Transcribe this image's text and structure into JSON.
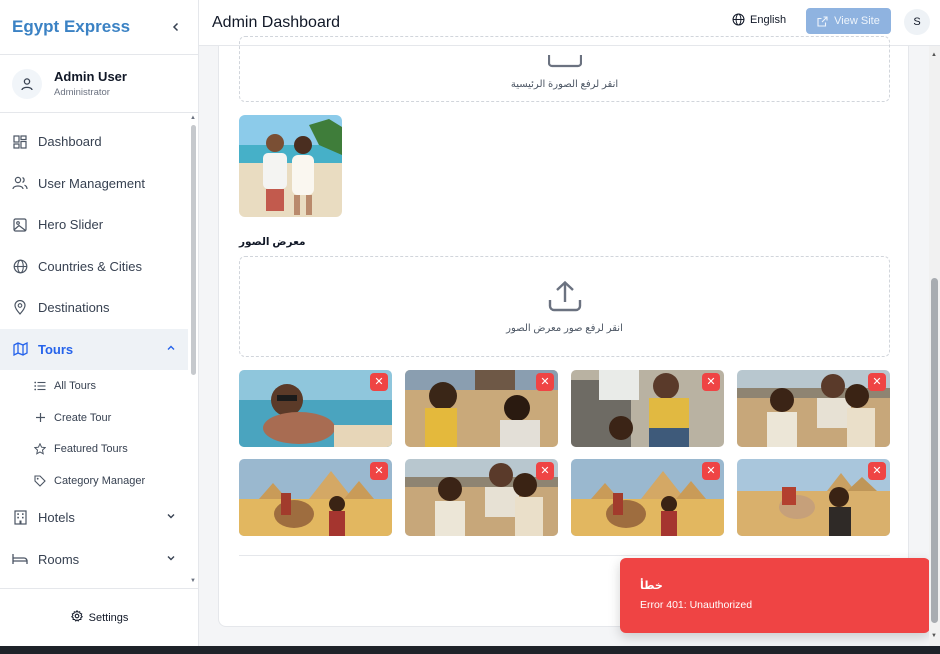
{
  "brand": {
    "title": "Egypt Express"
  },
  "profile": {
    "name": "Admin User",
    "role": "Administrator"
  },
  "nav": {
    "items": [
      {
        "label": "Dashboard",
        "icon": "dashboard-icon"
      },
      {
        "label": "User Management",
        "icon": "users-icon"
      },
      {
        "label": "Hero Slider",
        "icon": "image-icon"
      },
      {
        "label": "Countries & Cities",
        "icon": "globe-icon"
      },
      {
        "label": "Destinations",
        "icon": "map-pin-icon"
      },
      {
        "label": "Tours",
        "icon": "map-icon",
        "active": true
      },
      {
        "label": "Hotels",
        "icon": "building-icon"
      },
      {
        "label": "Rooms",
        "icon": "bed-icon"
      }
    ],
    "tour_subitems": [
      {
        "label": "All Tours",
        "icon": "list-icon"
      },
      {
        "label": "Create Tour",
        "icon": "plus-icon"
      },
      {
        "label": "Featured Tours",
        "icon": "star-icon"
      },
      {
        "label": "Category Manager",
        "icon": "tag-icon"
      }
    ]
  },
  "settings": {
    "label": "Settings"
  },
  "header": {
    "title": "Admin Dashboard",
    "language": "English",
    "view_site": "View Site",
    "user_initial": "S"
  },
  "main": {
    "main_image_upload": "انقر لرفع الصورة الرئيسية",
    "gallery_label": "معرض الصور",
    "gallery_upload": "انقر لرفع صور معرض الصور",
    "delete_glyph": "✕"
  },
  "toast": {
    "title": "خطأ",
    "message": "Error 401: Unauthorized",
    "color": "#ef4444"
  },
  "colors": {
    "accent": "#2563eb",
    "brand": "#3b82c4",
    "danger": "#ef4444"
  }
}
